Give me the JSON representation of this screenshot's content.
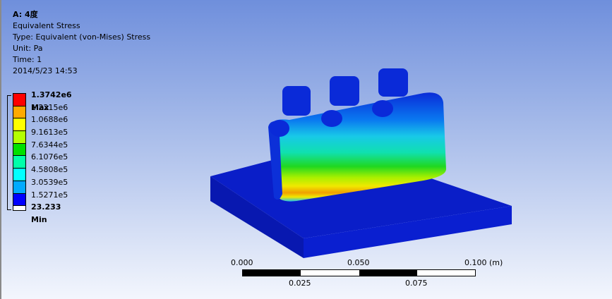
{
  "info": {
    "title": "A: 4度",
    "result": "Equivalent Stress",
    "type": "Type: Equivalent (von-Mises) Stress",
    "unit": "Unit: Pa",
    "time": "Time: 1",
    "timestamp": "2014/5/23 14:53"
  },
  "legend": {
    "labels": [
      "1.3742e6 Max",
      "1.2215e6",
      "1.0688e6",
      "9.1613e5",
      "7.6344e5",
      "6.1076e5",
      "4.5808e5",
      "3.0539e5",
      "1.5271e5",
      "23.233 Min"
    ],
    "colors": [
      "#ff0000",
      "#ffaa00",
      "#ffff00",
      "#b4ff00",
      "#00e000",
      "#00ffaa",
      "#00ffff",
      "#00aaff",
      "#0000ff"
    ]
  },
  "scale": {
    "top_labels": [
      "0.000",
      "0.050",
      "0.100 (m)"
    ],
    "bottom_labels": [
      "0.025",
      "0.075"
    ]
  }
}
